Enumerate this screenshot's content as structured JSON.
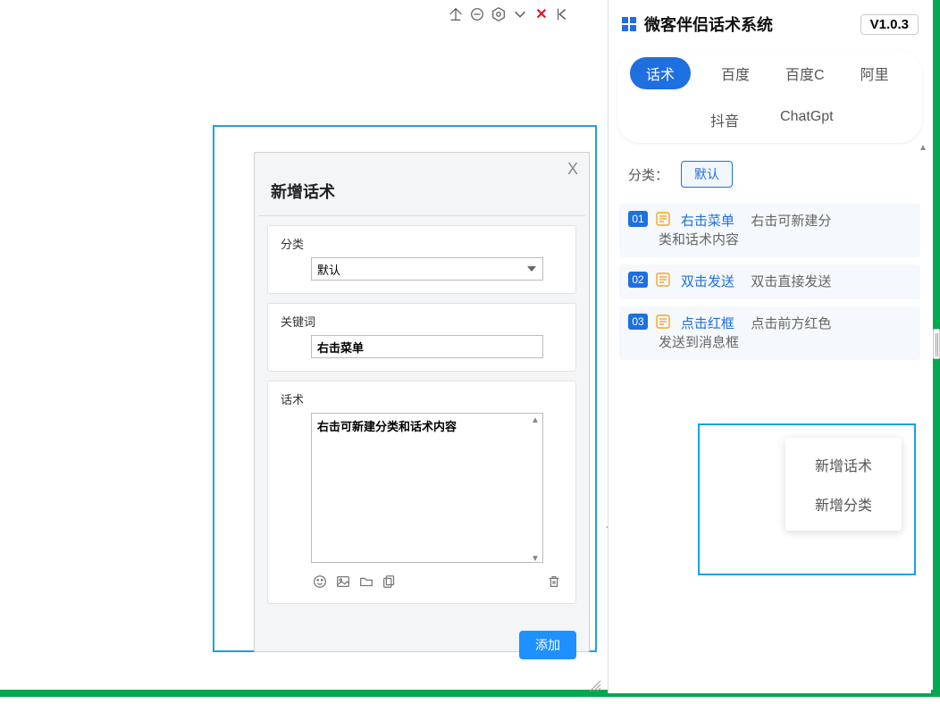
{
  "top_icons": [
    "home-up",
    "minus-circle",
    "gear-hex",
    "chevron-down",
    "close-x",
    "chevron-left"
  ],
  "dialog": {
    "title": "新增话术",
    "close": "X",
    "category_label": "分类",
    "category_value": "默认",
    "keyword_label": "关键词",
    "keyword_value": "右击菜单",
    "script_label": "话术",
    "script_value": "右击可新建分类和话术内容",
    "editor_icons": [
      "emoji",
      "image",
      "folder",
      "copy",
      "trash"
    ],
    "add_btn": "添加"
  },
  "panel": {
    "app_name": "微客伴侣话术系统",
    "version": "V1.0.3",
    "tabs": [
      "话术",
      "百度",
      "百度C",
      "阿里",
      "抖音",
      "ChatGpt"
    ],
    "active_tab": 0,
    "category_label": "分类：",
    "category_value": "默认",
    "hints": [
      {
        "num": "01",
        "blue": "右击菜单",
        "gray": "右击可新建分",
        "line2": "类和话术内容"
      },
      {
        "num": "02",
        "blue": "双击发送",
        "gray": "双击直接发送",
        "line2": ""
      },
      {
        "num": "03",
        "blue": "点击红框",
        "gray": "点击前方红色",
        "line2": "发送到消息框"
      }
    ],
    "context_menu": [
      "新增话术",
      "新增分类"
    ]
  }
}
